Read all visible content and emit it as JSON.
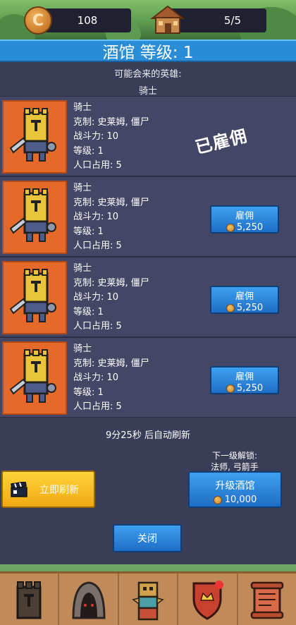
{
  "header": {
    "gold": "108",
    "population": "5/5",
    "coin_letter": "C"
  },
  "title": "酒馆 等级: 1",
  "possible_heroes": {
    "label": "可能会来的英雄:",
    "hero": "骑士"
  },
  "heroes": [
    {
      "name": "骑士",
      "counter": "克制: 史莱姆, 僵尸",
      "power": "战斗力: 10",
      "level": "等级: 1",
      "pop": "人口占用: 5",
      "hired": true,
      "status": "已雇佣"
    },
    {
      "name": "骑士",
      "counter": "克制: 史莱姆, 僵尸",
      "power": "战斗力: 10",
      "level": "等级: 1",
      "pop": "人口占用: 5",
      "hired": false,
      "button": "雇佣",
      "price": "5,250"
    },
    {
      "name": "骑士",
      "counter": "克制: 史莱姆, 僵尸",
      "power": "战斗力: 10",
      "level": "等级: 1",
      "pop": "人口占用: 5",
      "hired": false,
      "button": "雇佣",
      "price": "5,250"
    },
    {
      "name": "骑士",
      "counter": "克制: 史莱姆, 僵尸",
      "power": "战斗力: 10",
      "level": "等级: 1",
      "pop": "人口占用: 5",
      "hired": false,
      "button": "雇佣",
      "price": "5,250"
    }
  ],
  "refresh_timer": "9分25秒 后自动刷新",
  "next_unlock": {
    "label": "下一级解锁:",
    "units": "法师, 弓箭手"
  },
  "refresh_now": "立即刷新",
  "upgrade": {
    "label": "升级酒馆",
    "price": "10,000"
  },
  "close": "关闭",
  "nav": [
    "tower-icon",
    "cave-icon",
    "totem-icon",
    "shield-icon",
    "scroll-icon"
  ],
  "colors": {
    "title_blue": "#2a8dd8",
    "portrait_orange": "#e56a2a",
    "refresh_yellow": "#f0a811"
  }
}
